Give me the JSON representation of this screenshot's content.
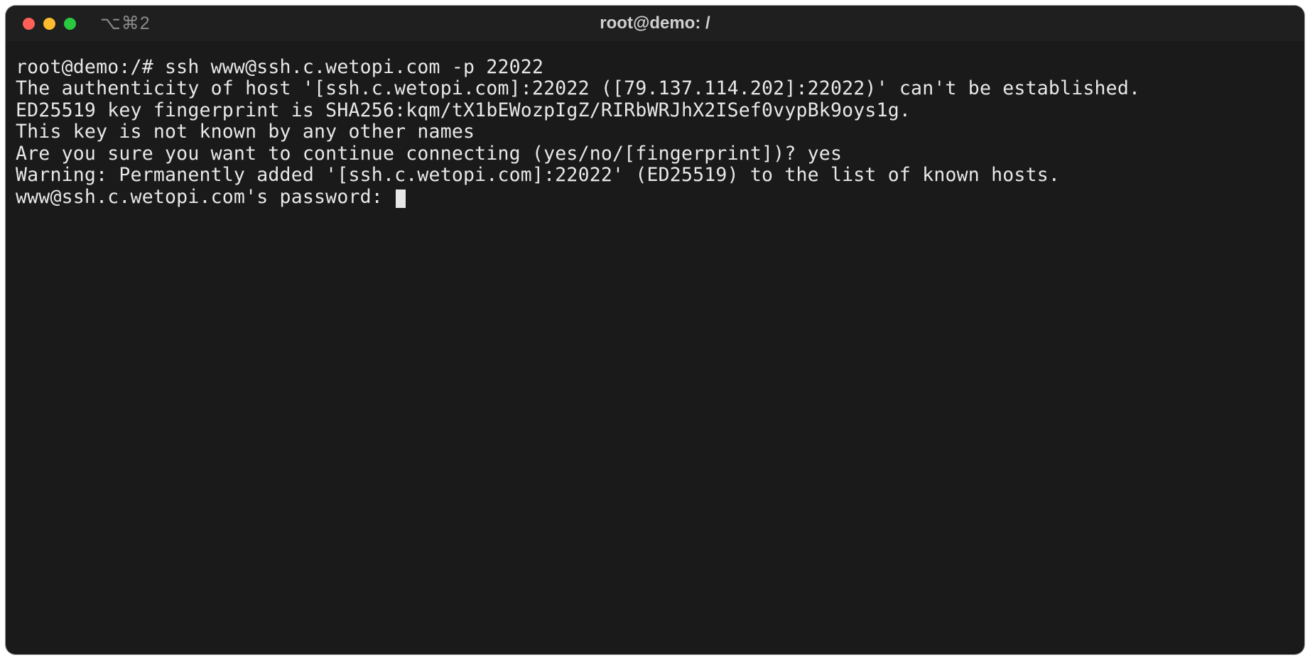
{
  "titlebar": {
    "shortcut": "⌥⌘2",
    "title": "root@demo: /"
  },
  "terminal": {
    "lines": [
      "root@demo:/# ssh www@ssh.c.wetopi.com -p 22022",
      "The authenticity of host '[ssh.c.wetopi.com]:22022 ([79.137.114.202]:22022)' can't be established.",
      "ED25519 key fingerprint is SHA256:kqm/tX1bEWozpIgZ/RIRbWRJhX2ISef0vypBk9oys1g.",
      "This key is not known by any other names",
      "Are you sure you want to continue connecting (yes/no/[fingerprint])? yes",
      "Warning: Permanently added '[ssh.c.wetopi.com]:22022' (ED25519) to the list of known hosts.",
      "www@ssh.c.wetopi.com's password: "
    ]
  }
}
